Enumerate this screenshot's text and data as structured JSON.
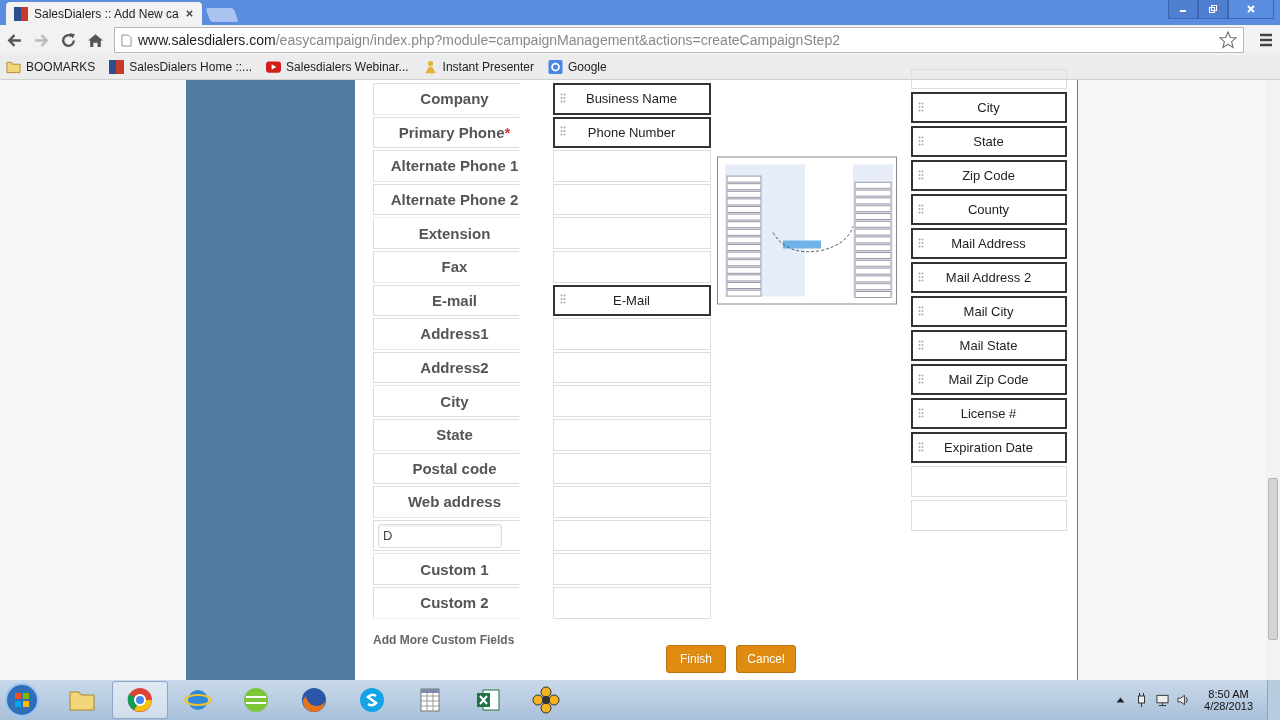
{
  "browser": {
    "tab_title": "SalesDialers :: Add New ca",
    "url_domain": "www.salesdialers.com",
    "url_path": "/easycampaign/index.php?module=campaignManagement&actions=createCampaignStep2",
    "bookmarks": [
      {
        "label": "BOOMARKS",
        "kind": "folder"
      },
      {
        "label": "SalesDialers Home ::...",
        "kind": "site"
      },
      {
        "label": "Salesdialers Webinar...",
        "kind": "video"
      },
      {
        "label": "Instant Presenter",
        "kind": "presenter"
      },
      {
        "label": "Google",
        "kind": "google"
      }
    ]
  },
  "fields": [
    {
      "kind": "label",
      "label": "Company",
      "required": false,
      "mapped": "Business Name"
    },
    {
      "kind": "label",
      "label": "Primary Phone",
      "required": true,
      "mapped": "Phone Number"
    },
    {
      "kind": "label",
      "label": "Alternate Phone 1",
      "required": false
    },
    {
      "kind": "label",
      "label": "Alternate Phone 2",
      "required": false
    },
    {
      "kind": "label",
      "label": "Extension",
      "required": false
    },
    {
      "kind": "label",
      "label": "Fax",
      "required": false
    },
    {
      "kind": "label",
      "label": "E-mail",
      "required": false,
      "mapped": "E-Mail"
    },
    {
      "kind": "label",
      "label": "Address1",
      "required": false
    },
    {
      "kind": "label",
      "label": "Address2",
      "required": false
    },
    {
      "kind": "label",
      "label": "City",
      "required": false
    },
    {
      "kind": "label",
      "label": "State",
      "required": false
    },
    {
      "kind": "label",
      "label": "Postal code",
      "required": false
    },
    {
      "kind": "label",
      "label": "Web address",
      "required": false
    },
    {
      "kind": "input",
      "value": "D"
    },
    {
      "kind": "label",
      "label": "Custom 1",
      "required": false
    },
    {
      "kind": "label",
      "label": "Custom 2",
      "required": false
    }
  ],
  "source_fields": [
    {
      "kind": "slot",
      "label": "City"
    },
    {
      "kind": "slot",
      "label": "State"
    },
    {
      "kind": "slot",
      "label": "Zip Code"
    },
    {
      "kind": "slot",
      "label": "County"
    },
    {
      "kind": "slot",
      "label": "Mail Address"
    },
    {
      "kind": "slot",
      "label": "Mail Address 2"
    },
    {
      "kind": "slot",
      "label": "Mail City"
    },
    {
      "kind": "slot",
      "label": "Mail State"
    },
    {
      "kind": "slot",
      "label": "Mail Zip Code"
    },
    {
      "kind": "slot",
      "label": "License #"
    },
    {
      "kind": "slot",
      "label": "Expiration Date"
    },
    {
      "kind": "empty"
    },
    {
      "kind": "empty"
    }
  ],
  "required_mark": "*",
  "add_more_link": "Add More Custom Fields",
  "buttons": [
    "Finish",
    "Cancel"
  ],
  "taskbar": {
    "time": "8:50 AM",
    "date": "4/28/2013"
  }
}
